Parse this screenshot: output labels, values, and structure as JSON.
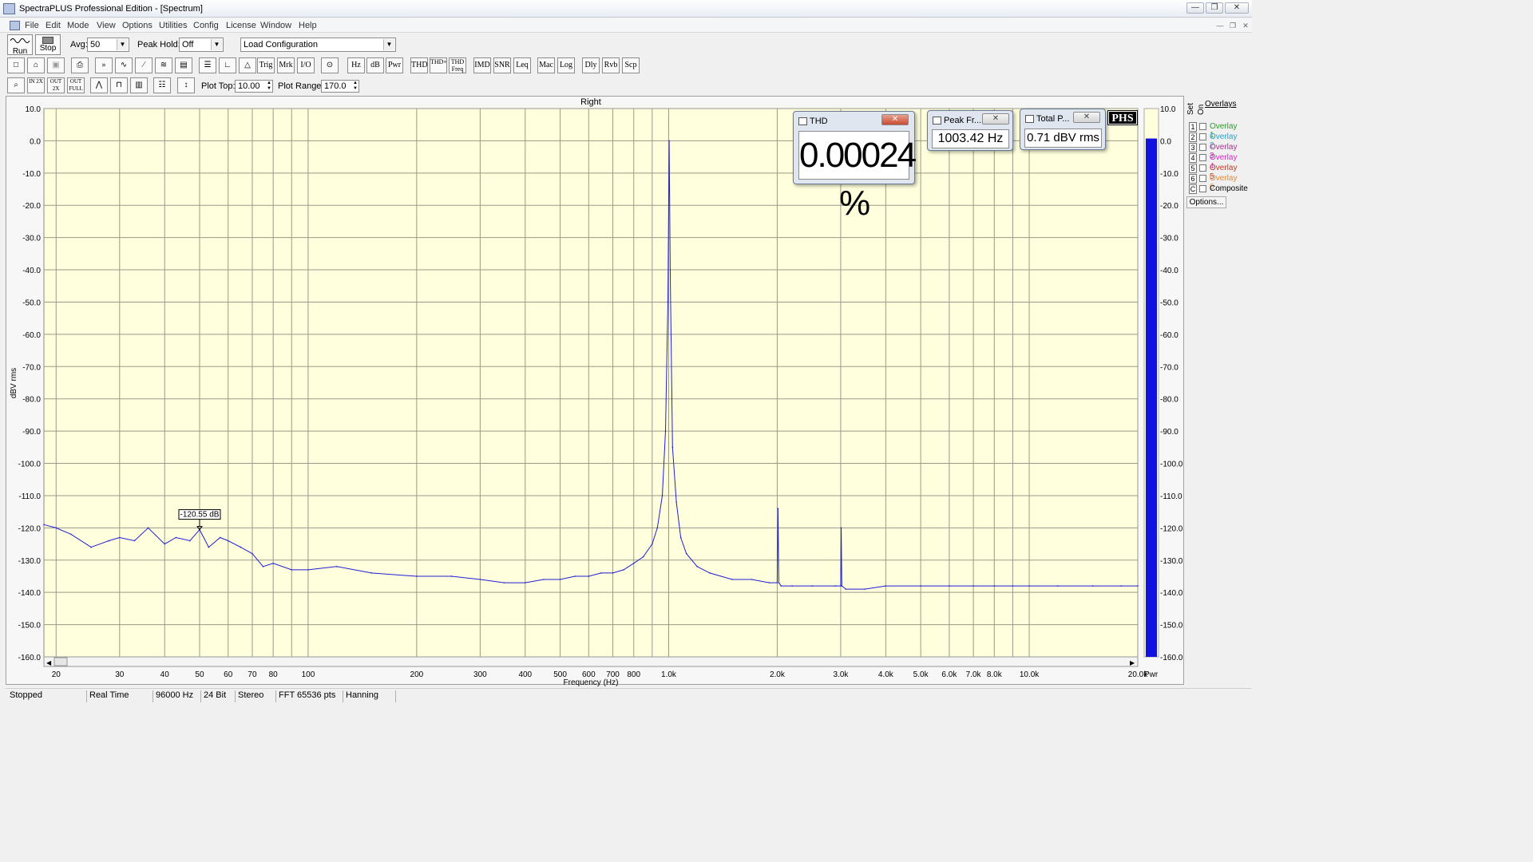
{
  "window": {
    "title": "SpectraPLUS Professional Edition - [Spectrum]",
    "minimize": "—",
    "maximize": "❐",
    "close": "✕"
  },
  "menu": [
    "File",
    "Edit",
    "Mode",
    "View",
    "Options",
    "Utilities",
    "Config",
    "License",
    "Window",
    "Help"
  ],
  "toolbar1": {
    "run_label": "Run",
    "stop_label": "Stop",
    "avg_label": "Avg:",
    "avg_value": "50",
    "peak_hold_label": "Peak Hold:",
    "peak_hold_value": "Off",
    "config_value": "Load Configuration"
  },
  "toolbar2": {
    "buttons": [
      "Trig",
      "Mrk",
      "I/O",
      "Hz",
      "dB",
      "Pwr",
      "THD",
      "THD+N",
      "THD Freq",
      "IMD",
      "SNR",
      "Leq",
      "Mac",
      "Log",
      "Dly",
      "Rvb",
      "Scp"
    ]
  },
  "toolbar3": {
    "zoom_buttons": [
      "IN 2X",
      "OUT 2X",
      "OUT FULL"
    ],
    "plot_top_label": "Plot Top:",
    "plot_top_value": "10.00",
    "plot_range_label": "Plot Range:",
    "plot_range_value": "170.0"
  },
  "plot": {
    "channel": "Right",
    "marker_label": "-120.55 dB",
    "logo": "PHS",
    "meter_side_label": "Pwr"
  },
  "meters": {
    "thd": {
      "title": "THD",
      "value": "0.00024 %"
    },
    "peak": {
      "title": "Peak Fr...",
      "value": "1003.42 Hz"
    },
    "total": {
      "title": "Total P...",
      "value": "0.71 dBV rms"
    }
  },
  "overlays": {
    "title": "Overlays",
    "set_label": "Set",
    "on_label": "On",
    "items": [
      {
        "num": "1",
        "label": "Overlay 1",
        "color": "#2e9b2e"
      },
      {
        "num": "2",
        "label": "Overlay 2",
        "color": "#2aa3c8"
      },
      {
        "num": "3",
        "label": "Overlay 3",
        "color": "#a6348a"
      },
      {
        "num": "4",
        "label": "Overlay 4",
        "color": "#d22ac9"
      },
      {
        "num": "5",
        "label": "Overlay 5",
        "color": "#c0392b"
      },
      {
        "num": "6",
        "label": "Overlay 6",
        "color": "#e08a3a"
      },
      {
        "num": "C",
        "label": "Composite",
        "color": "#000000"
      }
    ],
    "options_label": "Options..."
  },
  "status": {
    "state": "Stopped",
    "mode": "Real Time",
    "rate": "96000 Hz",
    "bits": "24 Bit",
    "channels": "Stereo",
    "fft": "FFT 65536 pts",
    "window": "Hanning"
  },
  "chart_data": {
    "type": "line",
    "title": "Right",
    "xlabel": "Frequency (Hz)",
    "ylabel": "dBV rms",
    "xscale": "log",
    "xlim": [
      18.5,
      20000
    ],
    "ylim": [
      -160,
      10
    ],
    "grid": true,
    "y_ticks": [
      "10.0",
      "0.0",
      "-10.0",
      "-20.0",
      "-30.0",
      "-40.0",
      "-50.0",
      "-60.0",
      "-70.0",
      "-80.0",
      "-90.0",
      "-100.0",
      "-110.0",
      "-120.0",
      "-130.0",
      "-140.0",
      "-150.0",
      "-160.0"
    ],
    "x_ticks": [
      {
        "f": 20,
        "label": "20"
      },
      {
        "f": 30,
        "label": "30"
      },
      {
        "f": 40,
        "label": "40"
      },
      {
        "f": 50,
        "label": "50"
      },
      {
        "f": 60,
        "label": "60"
      },
      {
        "f": 70,
        "label": "70"
      },
      {
        "f": 80,
        "label": "80"
      },
      {
        "f": 100,
        "label": "100"
      },
      {
        "f": 200,
        "label": "200"
      },
      {
        "f": 300,
        "label": "300"
      },
      {
        "f": 400,
        "label": "400"
      },
      {
        "f": 500,
        "label": "500"
      },
      {
        "f": 600,
        "label": "600"
      },
      {
        "f": 700,
        "label": "700"
      },
      {
        "f": 800,
        "label": "800"
      },
      {
        "f": 1000,
        "label": "1.0k"
      },
      {
        "f": 2000,
        "label": "2.0k"
      },
      {
        "f": 3000,
        "label": "3.0k"
      },
      {
        "f": 4000,
        "label": "4.0k"
      },
      {
        "f": 5000,
        "label": "5.0k"
      },
      {
        "f": 6000,
        "label": "6.0k"
      },
      {
        "f": 7000,
        "label": "7.0k"
      },
      {
        "f": 8000,
        "label": "8.0k"
      },
      {
        "f": 10000,
        "label": "10.0k"
      },
      {
        "f": 20000,
        "label": "20.0k"
      }
    ],
    "series": [
      {
        "color": "#1f1fd6",
        "x": [
          18.5,
          20,
          22,
          25,
          28,
          30,
          33,
          36,
          40,
          43,
          47,
          50,
          53,
          57,
          60,
          65,
          70,
          75,
          80,
          90,
          100,
          120,
          150,
          200,
          250,
          300,
          350,
          400,
          450,
          500,
          550,
          600,
          650,
          700,
          750,
          800,
          850,
          900,
          930,
          960,
          980,
          995,
          1003,
          1010,
          1025,
          1050,
          1080,
          1120,
          1200,
          1300,
          1500,
          1700,
          1900,
          2000,
          2010,
          2020,
          2050,
          2200,
          2500,
          2900,
          3000,
          3010,
          3020,
          3100,
          3500,
          4000,
          5000,
          6000,
          7000,
          8000,
          9000,
          10000,
          12000,
          15000,
          18000,
          20000
        ],
        "y": [
          -119,
          -120,
          -122,
          -126,
          -124,
          -123,
          -124,
          -120,
          -125,
          -123,
          -124,
          -120.55,
          -126,
          -123,
          -124,
          -126,
          -128,
          -132,
          -131,
          -133,
          -133,
          -132,
          -134,
          -135,
          -135,
          -136,
          -137,
          -137,
          -136,
          -136,
          -135,
          -135,
          -134,
          -134,
          -133,
          -131,
          -129,
          -125,
          -120,
          -110,
          -90,
          -50,
          0,
          -40,
          -95,
          -112,
          -123,
          -128,
          -132,
          -134,
          -136,
          -136,
          -137,
          -137,
          -114,
          -137,
          -138,
          -138,
          -138,
          -138,
          -138,
          -120,
          -138,
          -139,
          -139,
          -138,
          -138,
          -138,
          -138,
          -138,
          -138,
          -138,
          -138,
          -138,
          -138,
          -138
        ]
      }
    ],
    "meter": {
      "label": "Pwr",
      "level": 0.71,
      "ylim": [
        -160,
        10
      ]
    }
  }
}
